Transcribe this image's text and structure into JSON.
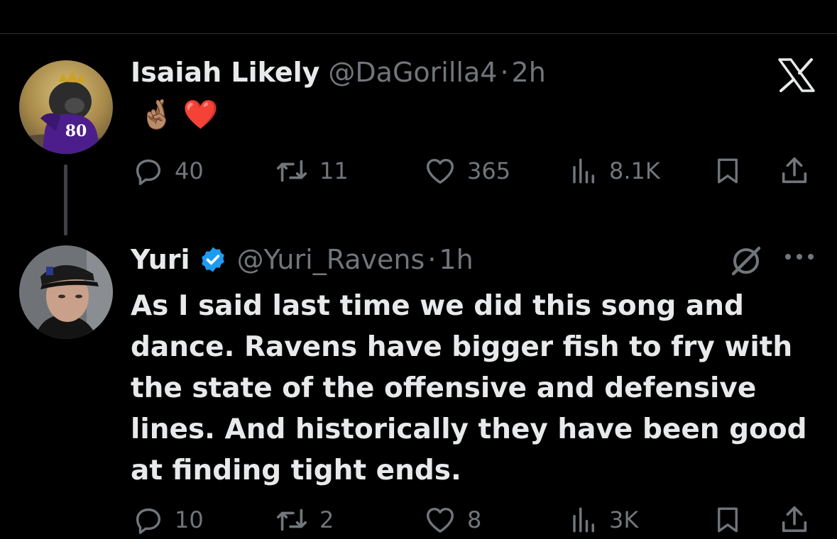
{
  "colors": {
    "background": "#000000",
    "text": "#e7e9ea",
    "muted": "#71767b",
    "verified": "#1d9bf0",
    "heart": "#f91880"
  },
  "tweet1": {
    "display_name": "Isaiah Likely",
    "handle": "@DaGorilla4",
    "separator": "·",
    "time": "2h",
    "emojis": [
      "🤞🏽",
      "❤️"
    ],
    "stats": {
      "replies": "40",
      "reposts": "11",
      "likes": "365",
      "views": "8.1K"
    }
  },
  "tweet2": {
    "display_name": "Yuri",
    "handle": "@Yuri_Ravens",
    "separator": "·",
    "time": "1h",
    "text": "As I said last time we did this song and dance. Ravens have bigger fish to fry with the state of the offensive and defensive lines. And historically they have been good at finding tight ends.",
    "stats": {
      "replies": "10",
      "reposts": "2",
      "likes": "8",
      "views": "3K"
    }
  },
  "avatar1_jersey_number": "80"
}
